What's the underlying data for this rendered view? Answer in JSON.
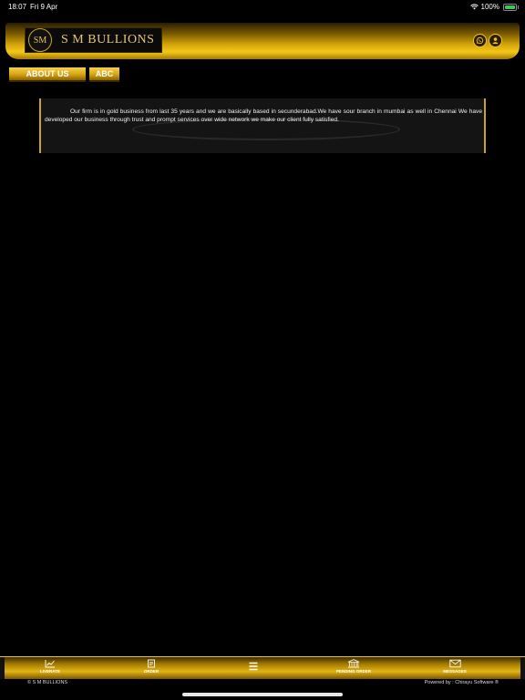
{
  "status_bar": {
    "time": "18:07",
    "date": "Fri 9 Apr",
    "battery_percent": "100%",
    "battery_fill": 1.0
  },
  "header": {
    "logo_emblem": "SM",
    "brand_name": "S M BULLIONS",
    "icons": [
      "whatsapp-icon",
      "user-icon"
    ]
  },
  "tabs": [
    {
      "label": "ABOUT US"
    },
    {
      "label": "ABC"
    }
  ],
  "about": {
    "text": "Our firm is in gold business from last 35 years and we are basically based in secunderabad.We have sour branch in mumbai as well in Chennai We have developed our business through trust and prompt services over wide network we make our client fully satisfied."
  },
  "bottom_nav": {
    "items": [
      {
        "label": "LIVERATE",
        "icon": "chart-icon"
      },
      {
        "label": "ORDER",
        "icon": "order-icon"
      },
      {
        "label": "",
        "icon": "menu-icon"
      },
      {
        "label": "PENDING ORDER",
        "icon": "bank-icon"
      },
      {
        "label": "MESSAGES",
        "icon": "mail-icon"
      }
    ]
  },
  "footer": {
    "copyright": "© S M BULLIONS",
    "powered_by": "Powered by : Chirayu Software ®"
  },
  "colors": {
    "gold": "#d4a60a",
    "gold_light": "#f4c81a",
    "background": "#000000",
    "battery_green": "#3cc75a"
  }
}
